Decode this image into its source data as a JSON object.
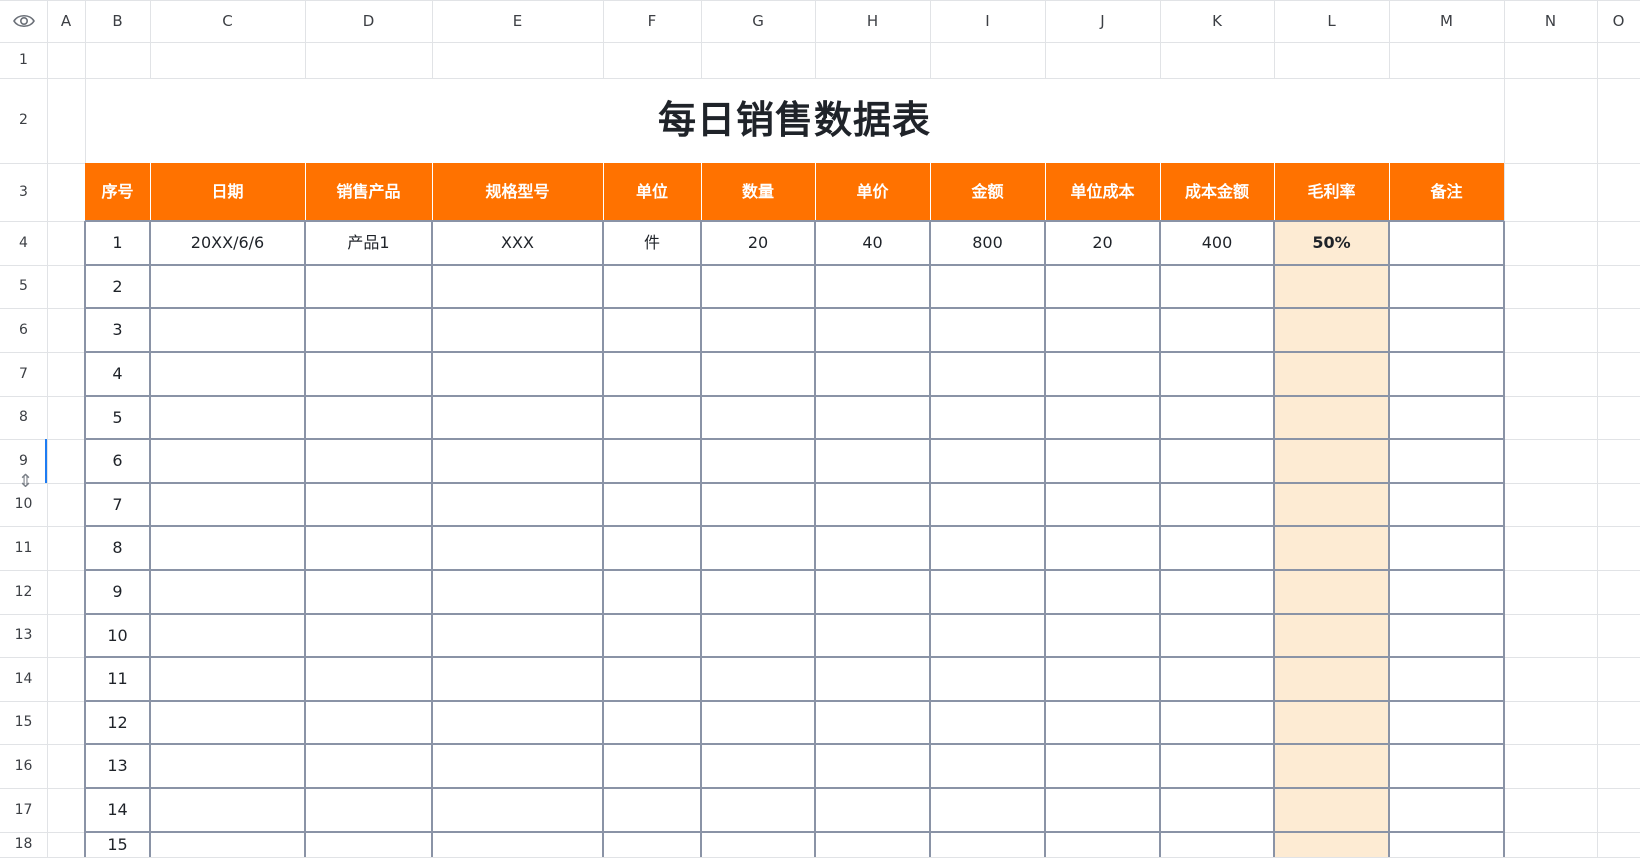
{
  "columns": [
    "A",
    "B",
    "C",
    "D",
    "E",
    "F",
    "G",
    "H",
    "I",
    "J",
    "K",
    "L",
    "M",
    "N",
    "O"
  ],
  "rows": [
    "1",
    "2",
    "3",
    "4",
    "5",
    "6",
    "7",
    "8",
    "9",
    "10",
    "11",
    "12",
    "13",
    "14",
    "15",
    "16",
    "17",
    "18"
  ],
  "title": "每日销售数据表",
  "table": {
    "headers": [
      "序号",
      "日期",
      "销售产品",
      "规格型号",
      "单位",
      "数量",
      "单价",
      "金额",
      "单位成本",
      "成本金额",
      "毛利率",
      "备注"
    ],
    "rows": [
      [
        "1",
        "20XX/6/6",
        "产品1",
        "XXX",
        "件",
        "20",
        "40",
        "800",
        "20",
        "400",
        "50%",
        ""
      ],
      [
        "2",
        "",
        "",
        "",
        "",
        "",
        "",
        "",
        "",
        "",
        "",
        ""
      ],
      [
        "3",
        "",
        "",
        "",
        "",
        "",
        "",
        "",
        "",
        "",
        "",
        ""
      ],
      [
        "4",
        "",
        "",
        "",
        "",
        "",
        "",
        "",
        "",
        "",
        "",
        ""
      ],
      [
        "5",
        "",
        "",
        "",
        "",
        "",
        "",
        "",
        "",
        "",
        "",
        ""
      ],
      [
        "6",
        "",
        "",
        "",
        "",
        "",
        "",
        "",
        "",
        "",
        "",
        ""
      ],
      [
        "7",
        "",
        "",
        "",
        "",
        "",
        "",
        "",
        "",
        "",
        "",
        ""
      ],
      [
        "8",
        "",
        "",
        "",
        "",
        "",
        "",
        "",
        "",
        "",
        "",
        ""
      ],
      [
        "9",
        "",
        "",
        "",
        "",
        "",
        "",
        "",
        "",
        "",
        "",
        ""
      ],
      [
        "10",
        "",
        "",
        "",
        "",
        "",
        "",
        "",
        "",
        "",
        "",
        ""
      ],
      [
        "11",
        "",
        "",
        "",
        "",
        "",
        "",
        "",
        "",
        "",
        "",
        ""
      ],
      [
        "12",
        "",
        "",
        "",
        "",
        "",
        "",
        "",
        "",
        "",
        "",
        ""
      ],
      [
        "13",
        "",
        "",
        "",
        "",
        "",
        "",
        "",
        "",
        "",
        "",
        ""
      ],
      [
        "14",
        "",
        "",
        "",
        "",
        "",
        "",
        "",
        "",
        "",
        "",
        ""
      ],
      [
        "15",
        "",
        "",
        "",
        "",
        "",
        "",
        "",
        "",
        "",
        "",
        ""
      ]
    ]
  },
  "colors": {
    "header_bg": "#ff7200",
    "margin_col_bg": "#fdebd3",
    "border": "#8a93a6",
    "selection": "#1e7cf2"
  },
  "icons": {
    "visibility": "eye-icon",
    "row_resize": "row-resize-icon"
  }
}
